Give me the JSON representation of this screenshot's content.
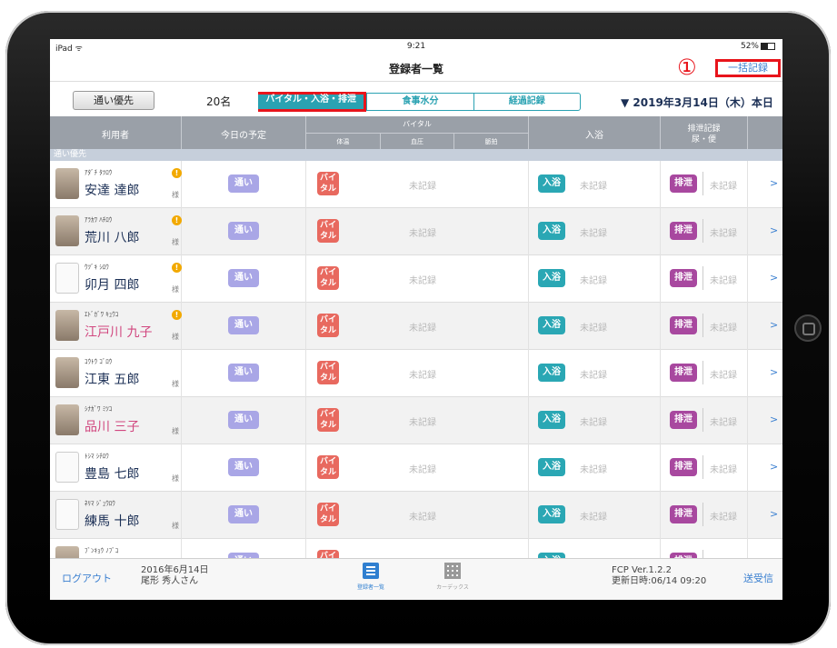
{
  "status": {
    "carrier": "iPad ᯤ",
    "time": "9:21",
    "battery": "52%"
  },
  "nav": {
    "title": "登録者一覧",
    "batch_label": "一括記録",
    "marker": "①"
  },
  "toolbar": {
    "priority_label": "通い優先",
    "count": "20名",
    "segments": [
      "バイタル・入浴・排泄",
      "食事水分",
      "経過記録"
    ],
    "date": "▼ 2019年3月14日（木）本日"
  },
  "table": {
    "headers": {
      "user": "利用者",
      "schedule": "今日の予定",
      "vital": "バイタル",
      "vital_sub": [
        "体温",
        "血圧",
        "脈拍"
      ],
      "bath": "入浴",
      "excretion_1": "排泄記録",
      "excretion_2": "尿・便"
    },
    "section": "通い優先",
    "badges": {
      "tsuu": "通い",
      "vital_1": "バイ",
      "vital_2": "タル",
      "bath": "入浴",
      "excretion": "排泄",
      "unrecorded": "未記録",
      "sama": "様",
      "chevron": ">"
    },
    "rows": [
      {
        "kana": "ｱﾀﾞﾁ ﾀﾂﾛｳ",
        "name": "安達 達郎",
        "warn": "!"
      },
      {
        "kana": "ｱﾗｶﾜ ﾊﾁﾛｳ",
        "name": "荒川 八郎",
        "warn": "!"
      },
      {
        "kana": "ｳﾂﾞｷ ｼﾛｳ",
        "name": "卯月 四郎",
        "warn": "!"
      },
      {
        "kana": "ｴﾄﾞｶﾞﾜ ｷｭｳｺ",
        "name": "江戸川 九子",
        "warn": "!"
      },
      {
        "kana": "ｺｳﾄｳ ｺﾞﾛｳ",
        "name": "江東 五郎",
        "warn": ""
      },
      {
        "kana": "ｼﾅｶﾞﾜ ﾐﾂｺ",
        "name": "品川 三子",
        "warn": ""
      },
      {
        "kana": "ﾄｼﾏ ｼﾁﾛｳ",
        "name": "豊島 七郎",
        "warn": ""
      },
      {
        "kana": "ﾈﾘﾏ ｼﾞｭｳﾛｳ",
        "name": "練馬 十郎",
        "warn": ""
      },
      {
        "kana": "ﾌﾞﾝｷｮｳ ﾉﾌﾞｺ",
        "name": "",
        "warn": ""
      }
    ]
  },
  "tabbar": {
    "logout": "ログアウト",
    "date": "2016年6月14日",
    "user": "尾形 秀人さん",
    "tab1": "登録者一覧",
    "tab2": "カーデックス",
    "version": "FCP Ver.1.2.2",
    "updated": "更新日時:06/14 09:20",
    "send": "送受信"
  }
}
